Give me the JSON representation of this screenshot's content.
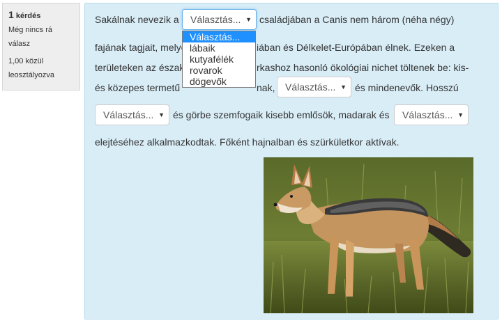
{
  "question": {
    "label": "kérdés",
    "number": "1",
    "status": "Még nincs rá válasz",
    "grade": "1,00 közül leosztályozva"
  },
  "text": {
    "line1a": "Sakálnak nevezik a",
    "line1b": "családjában a Canis nem három (néha négy)",
    "line2a": "fajának tagjait, melye",
    "line2b": "iában és Délkelet-Európában élnek. Ezeken a",
    "line3a": "területeken az északa",
    "line3b": "rkashoz hasonló ökológiai nichet töltenek be: kis-",
    "line4a": "és közepes termetű",
    "line4b": "nak,",
    "line4c": "és mindenevők. Hosszú",
    "line5": "és görbe szemfogaik kisebb emlősök, madarak és",
    "line6": "elejtéséhez alkalmazkodtak. Főként hajnalban és szürkületkor aktívak."
  },
  "selects": {
    "select1": "Választás...",
    "select2": "Választás...",
    "select3": "Választás...",
    "select4": "Választás..."
  },
  "dropdown": {
    "options": [
      "Választás...",
      "lábaik",
      "kutyafélék",
      "rovarok",
      "dögevők"
    ],
    "highlighted": 0
  },
  "image": {
    "subject": "black-backed jackal photo"
  },
  "colors": {
    "panel": "#d9edf7",
    "info": "#eeeeee",
    "highlight": "#1e90ff"
  }
}
